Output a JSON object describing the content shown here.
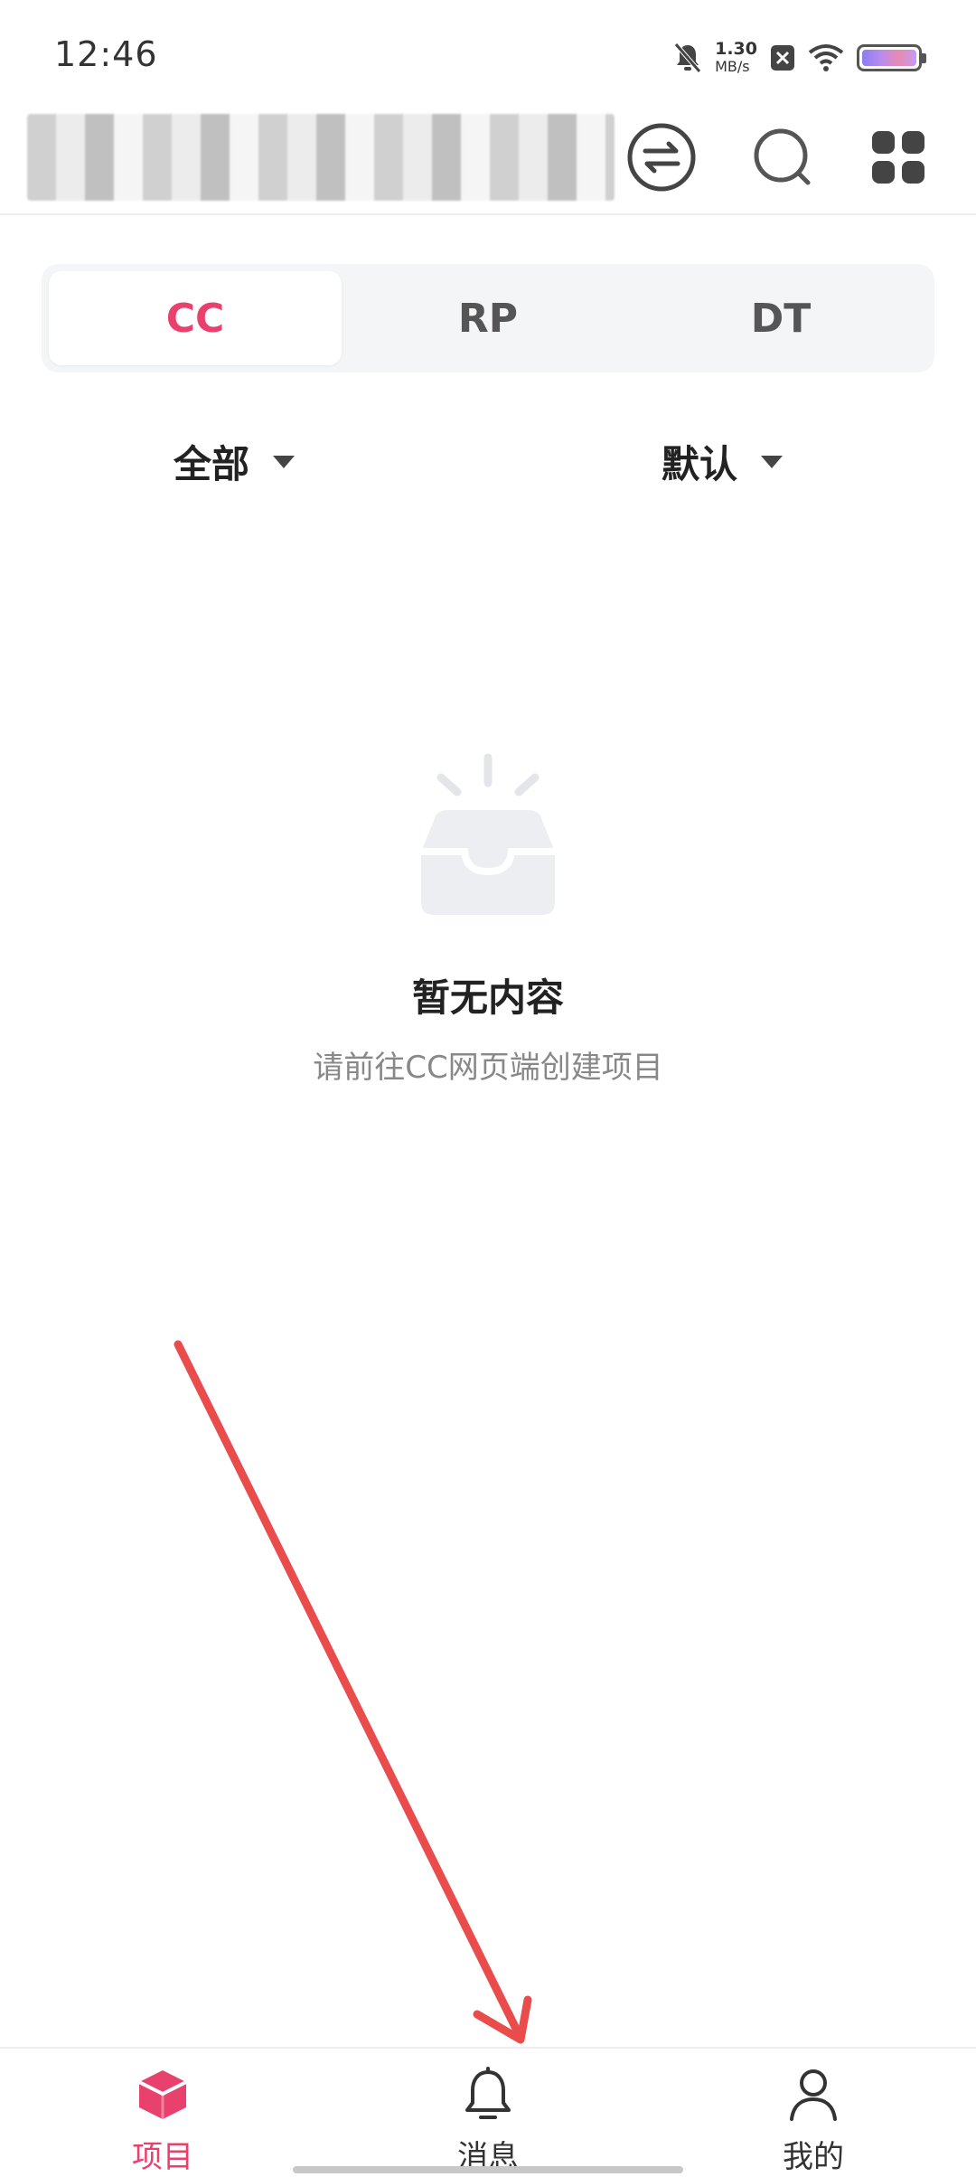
{
  "status_bar": {
    "time": "12:46",
    "net_speed_value": "1.30",
    "net_speed_unit": "MB/s",
    "icons": [
      "bell-muted-icon",
      "close-box-icon",
      "wifi-icon",
      "battery-icon"
    ]
  },
  "header": {
    "title": "",
    "icons": [
      "switch-icon",
      "search-icon",
      "apps-grid-icon"
    ]
  },
  "tabs": [
    {
      "label": "CC",
      "active": true
    },
    {
      "label": "RP",
      "active": false
    },
    {
      "label": "DT",
      "active": false
    }
  ],
  "filters": {
    "scope": "全部",
    "sort": "默认"
  },
  "empty_state": {
    "title": "暂无内容",
    "description": "请前往CC网页端创建项目",
    "icon": "empty-inbox-icon"
  },
  "bottom_nav": [
    {
      "label": "项目",
      "icon": "project-cube-icon",
      "active": true
    },
    {
      "label": "消息",
      "icon": "bell-icon",
      "active": false
    },
    {
      "label": "我的",
      "icon": "person-icon",
      "active": false
    }
  ],
  "colors": {
    "accent": "#e8416d",
    "annotation_arrow": "#ea4b4b",
    "tab_bg": "#f4f5f7"
  }
}
